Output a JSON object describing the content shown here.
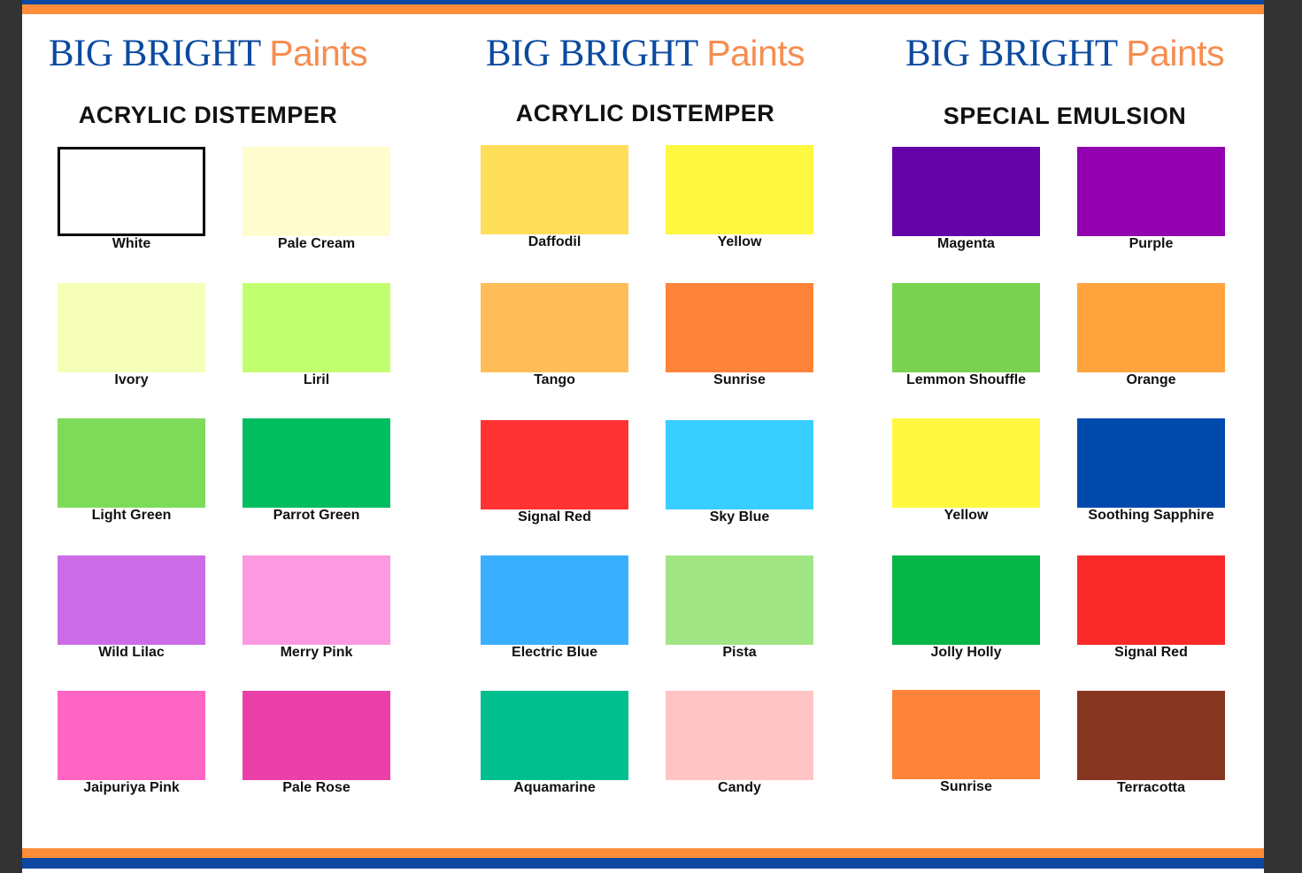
{
  "columns": [
    {
      "brand_main": "BIG BRIGHT",
      "brand_accent": "Paints",
      "section_title": "ACRYLIC DISTEMPER",
      "swatches": [
        {
          "label": "White",
          "color": "#ffffff"
        },
        {
          "label": "Pale Cream",
          "color": "#fffccf"
        },
        {
          "label": "Ivory",
          "color": "#f6ffb8"
        },
        {
          "label": "Liril",
          "color": "#c2ff70"
        },
        {
          "label": "Light Green",
          "color": "#7edb5a"
        },
        {
          "label": "Parrot Green",
          "color": "#00be5f"
        },
        {
          "label": "Wild Lilac",
          "color": "#cb6ce6"
        },
        {
          "label": "Merry Pink",
          "color": "#fd99e0"
        },
        {
          "label": "Jaipuriya Pink",
          "color": "#ff66c4"
        },
        {
          "label": "Pale Rose",
          "color": "#eb40a8"
        }
      ]
    },
    {
      "brand_main": "BIG BRIGHT",
      "brand_accent": "Paints",
      "section_title": "ACRYLIC DISTEMPER",
      "swatches": [
        {
          "label": "Daffodil",
          "color": "#ffde59"
        },
        {
          "label": "Yellow",
          "color": "#fff740"
        },
        {
          "label": "Tango",
          "color": "#ffbd59"
        },
        {
          "label": "Sunrise",
          "color": "#ff8339"
        },
        {
          "label": "Signal Red",
          "color": "#ff3333"
        },
        {
          "label": "Sky Blue",
          "color": "#38ceff"
        },
        {
          "label": "Electric Blue",
          "color": "#38b0ff"
        },
        {
          "label": "Pista",
          "color": "#a1e584"
        },
        {
          "label": "Aquamarine",
          "color": "#00bf8f"
        },
        {
          "label": "Candy",
          "color": "#ffc4c4"
        }
      ]
    },
    {
      "brand_main": "BIG BRIGHT",
      "brand_accent": "Paints",
      "section_title": "SPECIAL EMULSION",
      "swatches": [
        {
          "label": "Magenta",
          "color": "#6403a8"
        },
        {
          "label": "Purple",
          "color": "#9300b0"
        },
        {
          "label": "Lemmon Shouffle",
          "color": "#7ad350"
        },
        {
          "label": "Orange",
          "color": "#ffa43d"
        },
        {
          "label": "Yellow",
          "color": "#fff740"
        },
        {
          "label": "Soothing Sapphire",
          "color": "#004aad"
        },
        {
          "label": "Jolly Holly",
          "color": "#06b646"
        },
        {
          "label": "Signal Red",
          "color": "#fa2a2a"
        },
        {
          "label": "Sunrise",
          "color": "#ff8339"
        },
        {
          "label": "Terracotta",
          "color": "#873621"
        }
      ]
    }
  ]
}
